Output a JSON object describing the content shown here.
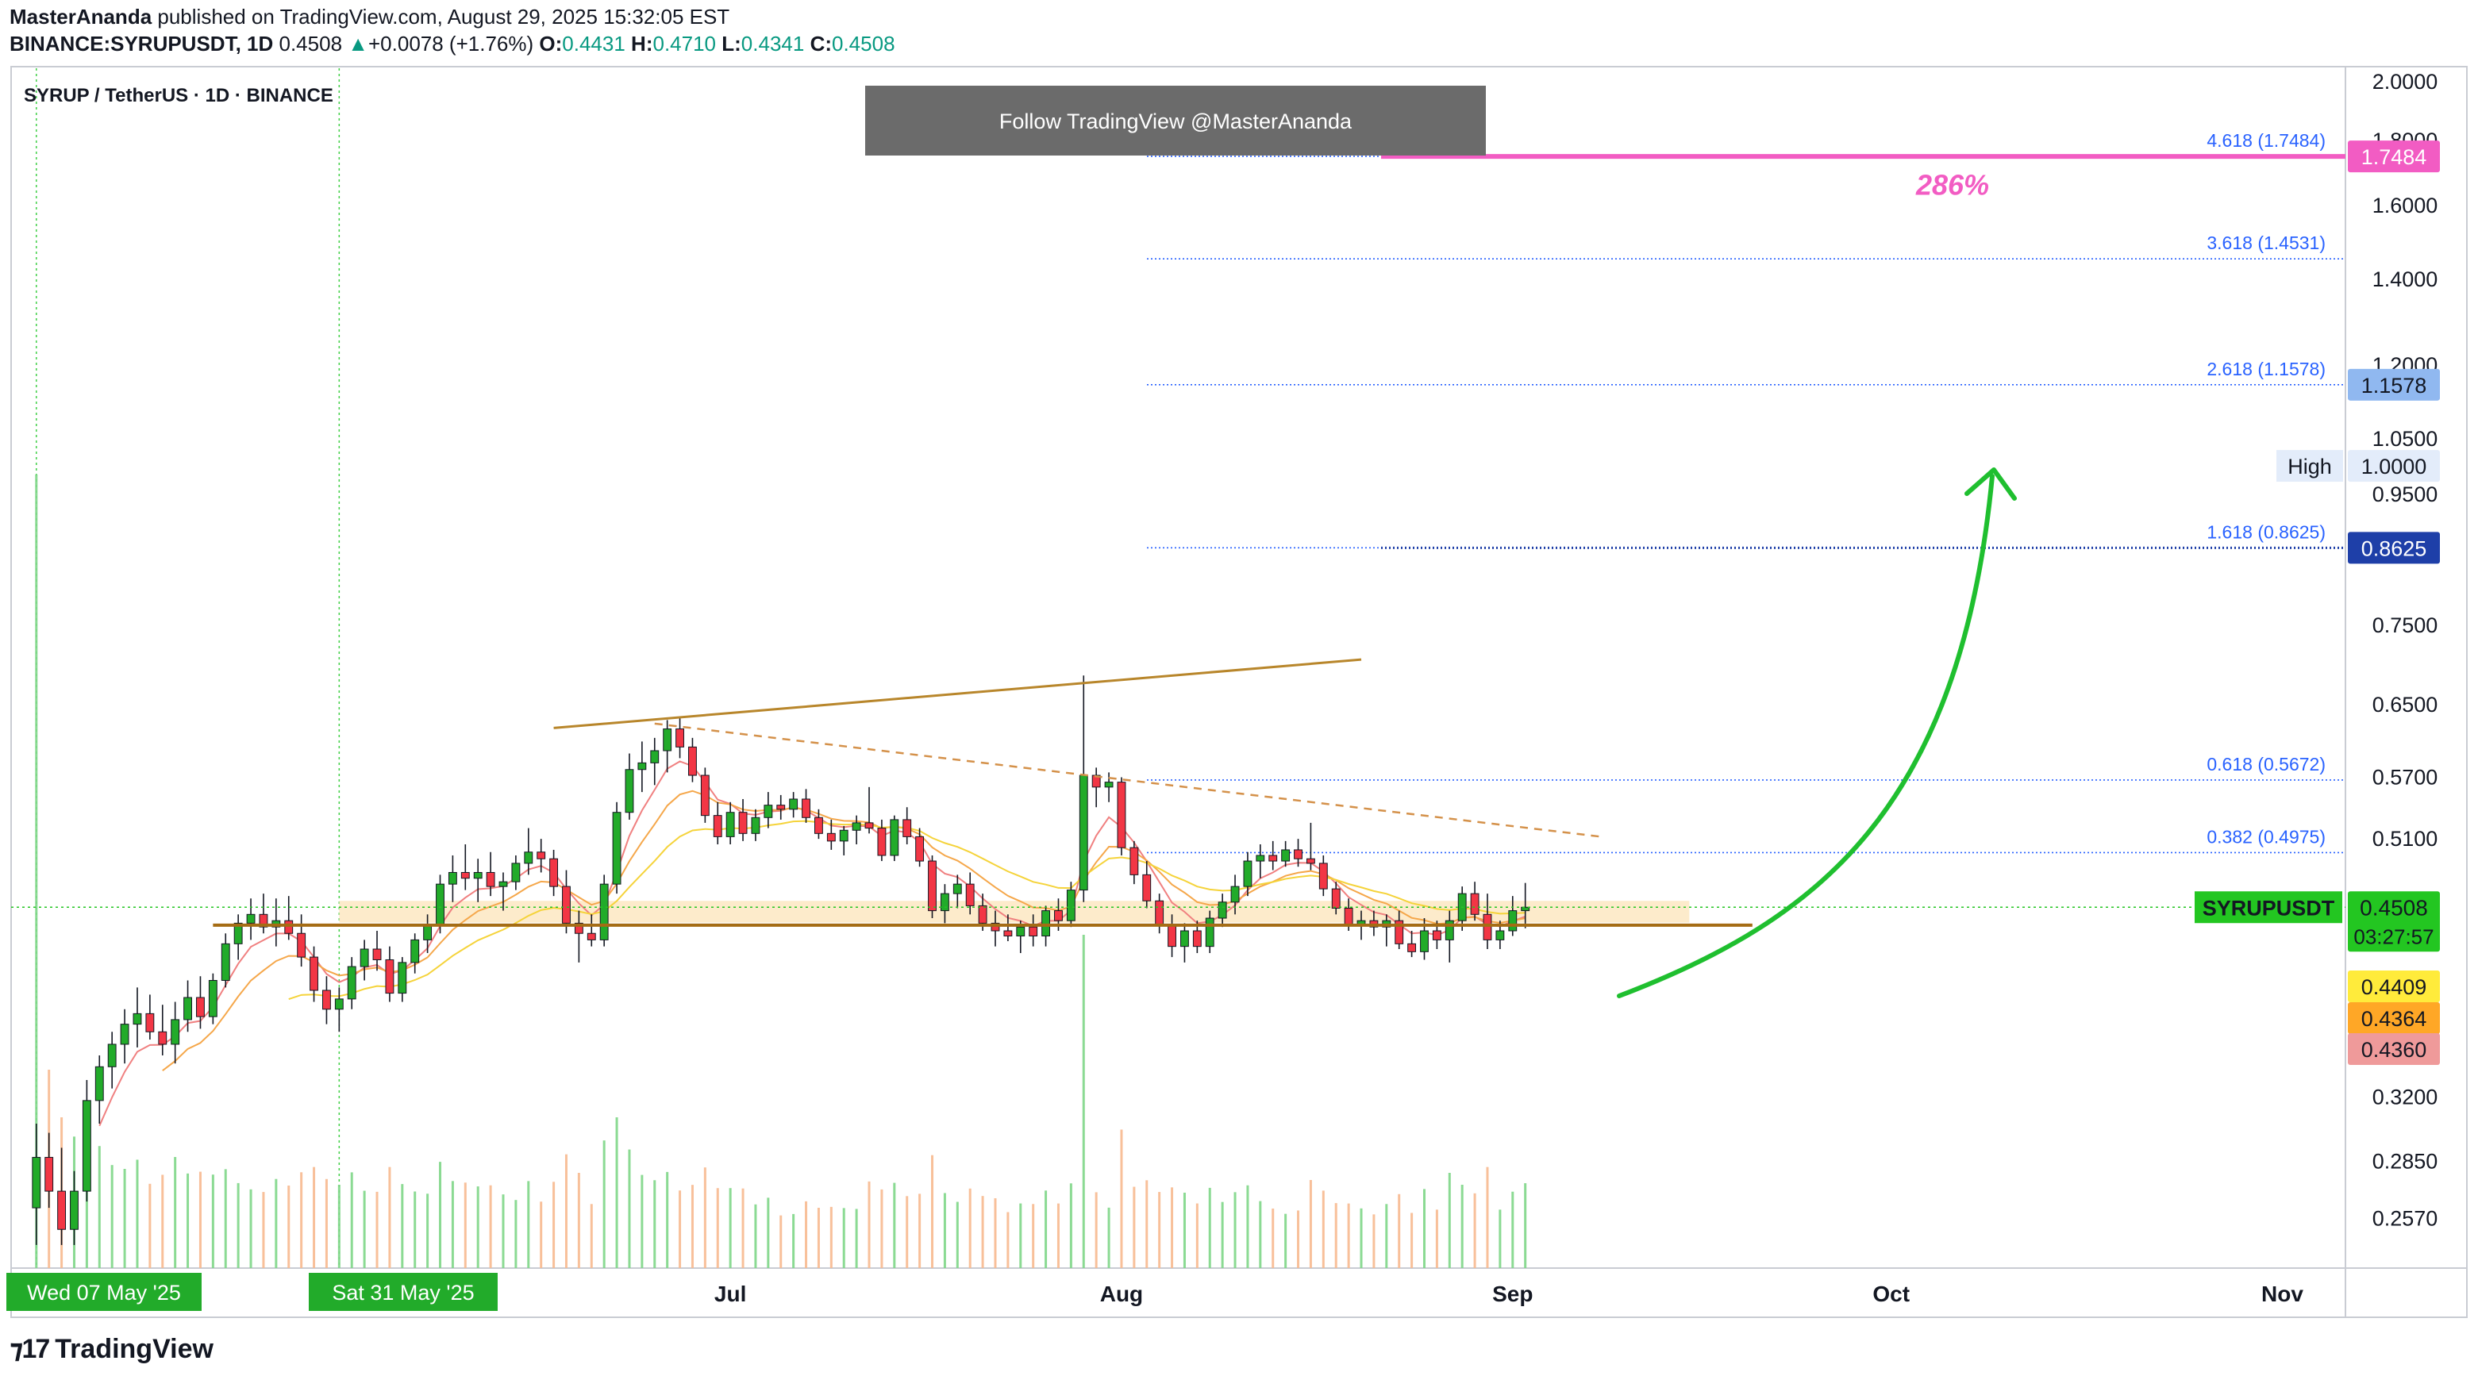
{
  "header": {
    "author": "MasterAnanda",
    "published_text": "published on TradingView.com, August 29, 2025 15:32:05 EST",
    "symbol_line": "BINANCE:SYRUPUSDT, 1D",
    "last": "0.4508",
    "change": "+0.0078 (+1.76%)",
    "open_label": "O:",
    "open": "0.4431",
    "high_label": "H:",
    "high": "0.4710",
    "low_label": "L:",
    "low": "0.4341",
    "close_label": "C:",
    "close": "0.4508"
  },
  "chart_title": "SYRUP / TetherUS · 1D · BINANCE",
  "banner": "Follow TradingView @MasterAnanda",
  "footer": {
    "brand": "TradingView"
  },
  "colors": {
    "up": "#089981",
    "up_candle": "#22ab2a",
    "down_candle": "#f23645",
    "fib": "#2962ff",
    "target": "#f25cc3",
    "arrow": "#1fbf2f",
    "trend": "#b8862b",
    "zone": "#fde7c2",
    "last_price": "#23c621",
    "label_yellow": "#ffeb3b",
    "label_orange": "#ffa726",
    "label_red": "#ef9a9a",
    "label_blue": "#90b8f0",
    "label_navy": "#1e3fa8"
  },
  "chart_data": {
    "type": "candlestick",
    "title": "SYRUP / TetherUS · 1D · BINANCE",
    "y_scale": "log",
    "ylim": [
      0.235,
      2.05
    ],
    "x_range": [
      "2025-05-05",
      "2025-11-06"
    ],
    "x_ticks": [
      {
        "date": "2025-07-01",
        "label": "Jul"
      },
      {
        "date": "2025-08-01",
        "label": "Aug"
      },
      {
        "date": "2025-09-01",
        "label": "Sep"
      },
      {
        "date": "2025-10-01",
        "label": "Oct"
      },
      {
        "date": "2025-11-01",
        "label": "Nov"
      }
    ],
    "x_highlight_labels": [
      {
        "date": "2025-05-07",
        "label": "Wed 07 May '25"
      },
      {
        "date": "2025-05-31",
        "label": "Sat 31 May '25"
      }
    ],
    "y_ticks": [
      "2.0000",
      "1.8000",
      "1.6000",
      "1.4000",
      "1.2000",
      "1.0500",
      "0.9500",
      "0.7500",
      "0.6500",
      "0.5700",
      "0.5100",
      "0.3200",
      "0.2850",
      "0.2570"
    ],
    "candles": [
      {
        "d": "2025-05-07",
        "o": 0.262,
        "h": 0.305,
        "l": 0.245,
        "c": 0.287
      },
      {
        "d": "2025-05-08",
        "o": 0.287,
        "h": 0.3,
        "l": 0.262,
        "c": 0.27
      },
      {
        "d": "2025-05-09",
        "o": 0.27,
        "h": 0.292,
        "l": 0.245,
        "c": 0.252
      },
      {
        "d": "2025-05-10",
        "o": 0.252,
        "h": 0.28,
        "l": 0.245,
        "c": 0.27
      },
      {
        "d": "2025-05-11",
        "o": 0.27,
        "h": 0.33,
        "l": 0.265,
        "c": 0.318
      },
      {
        "d": "2025-05-12",
        "o": 0.318,
        "h": 0.345,
        "l": 0.305,
        "c": 0.338
      },
      {
        "d": "2025-05-13",
        "o": 0.338,
        "h": 0.36,
        "l": 0.325,
        "c": 0.352
      },
      {
        "d": "2025-05-14",
        "o": 0.352,
        "h": 0.375,
        "l": 0.34,
        "c": 0.365
      },
      {
        "d": "2025-05-15",
        "o": 0.365,
        "h": 0.39,
        "l": 0.35,
        "c": 0.372
      },
      {
        "d": "2025-05-16",
        "o": 0.372,
        "h": 0.385,
        "l": 0.355,
        "c": 0.36
      },
      {
        "d": "2025-05-17",
        "o": 0.36,
        "h": 0.378,
        "l": 0.345,
        "c": 0.352
      },
      {
        "d": "2025-05-18",
        "o": 0.352,
        "h": 0.38,
        "l": 0.34,
        "c": 0.368
      },
      {
        "d": "2025-05-19",
        "o": 0.368,
        "h": 0.395,
        "l": 0.36,
        "c": 0.383
      },
      {
        "d": "2025-05-20",
        "o": 0.383,
        "h": 0.398,
        "l": 0.362,
        "c": 0.37
      },
      {
        "d": "2025-05-21",
        "o": 0.37,
        "h": 0.4,
        "l": 0.365,
        "c": 0.395
      },
      {
        "d": "2025-05-22",
        "o": 0.395,
        "h": 0.43,
        "l": 0.39,
        "c": 0.422
      },
      {
        "d": "2025-05-23",
        "o": 0.422,
        "h": 0.445,
        "l": 0.41,
        "c": 0.438
      },
      {
        "d": "2025-05-24",
        "o": 0.438,
        "h": 0.458,
        "l": 0.425,
        "c": 0.445
      },
      {
        "d": "2025-05-25",
        "o": 0.445,
        "h": 0.462,
        "l": 0.43,
        "c": 0.435
      },
      {
        "d": "2025-05-26",
        "o": 0.435,
        "h": 0.458,
        "l": 0.42,
        "c": 0.44
      },
      {
        "d": "2025-05-27",
        "o": 0.44,
        "h": 0.46,
        "l": 0.425,
        "c": 0.43
      },
      {
        "d": "2025-05-28",
        "o": 0.43,
        "h": 0.445,
        "l": 0.405,
        "c": 0.412
      },
      {
        "d": "2025-05-29",
        "o": 0.412,
        "h": 0.42,
        "l": 0.38,
        "c": 0.388
      },
      {
        "d": "2025-05-30",
        "o": 0.388,
        "h": 0.398,
        "l": 0.365,
        "c": 0.375
      },
      {
        "d": "2025-05-31",
        "o": 0.375,
        "h": 0.39,
        "l": 0.36,
        "c": 0.382
      },
      {
        "d": "2025-06-01",
        "o": 0.382,
        "h": 0.412,
        "l": 0.375,
        "c": 0.405
      },
      {
        "d": "2025-06-02",
        "o": 0.405,
        "h": 0.425,
        "l": 0.395,
        "c": 0.418
      },
      {
        "d": "2025-06-03",
        "o": 0.418,
        "h": 0.432,
        "l": 0.402,
        "c": 0.41
      },
      {
        "d": "2025-06-04",
        "o": 0.41,
        "h": 0.42,
        "l": 0.38,
        "c": 0.386
      },
      {
        "d": "2025-06-05",
        "o": 0.386,
        "h": 0.412,
        "l": 0.38,
        "c": 0.408
      },
      {
        "d": "2025-06-06",
        "o": 0.408,
        "h": 0.43,
        "l": 0.4,
        "c": 0.425
      },
      {
        "d": "2025-06-07",
        "o": 0.425,
        "h": 0.445,
        "l": 0.415,
        "c": 0.436
      },
      {
        "d": "2025-06-08",
        "o": 0.436,
        "h": 0.478,
        "l": 0.43,
        "c": 0.47
      },
      {
        "d": "2025-06-09",
        "o": 0.47,
        "h": 0.495,
        "l": 0.455,
        "c": 0.48
      },
      {
        "d": "2025-06-10",
        "o": 0.48,
        "h": 0.505,
        "l": 0.465,
        "c": 0.475
      },
      {
        "d": "2025-06-11",
        "o": 0.475,
        "h": 0.492,
        "l": 0.455,
        "c": 0.48
      },
      {
        "d": "2025-06-12",
        "o": 0.48,
        "h": 0.498,
        "l": 0.46,
        "c": 0.468
      },
      {
        "d": "2025-06-13",
        "o": 0.468,
        "h": 0.48,
        "l": 0.448,
        "c": 0.472
      },
      {
        "d": "2025-06-14",
        "o": 0.472,
        "h": 0.495,
        "l": 0.465,
        "c": 0.488
      },
      {
        "d": "2025-06-15",
        "o": 0.488,
        "h": 0.52,
        "l": 0.478,
        "c": 0.498
      },
      {
        "d": "2025-06-16",
        "o": 0.498,
        "h": 0.51,
        "l": 0.48,
        "c": 0.492
      },
      {
        "d": "2025-06-17",
        "o": 0.492,
        "h": 0.5,
        "l": 0.46,
        "c": 0.468
      },
      {
        "d": "2025-06-18",
        "o": 0.468,
        "h": 0.482,
        "l": 0.43,
        "c": 0.438
      },
      {
        "d": "2025-06-19",
        "o": 0.438,
        "h": 0.448,
        "l": 0.408,
        "c": 0.43
      },
      {
        "d": "2025-06-20",
        "o": 0.43,
        "h": 0.445,
        "l": 0.42,
        "c": 0.425
      },
      {
        "d": "2025-06-21",
        "o": 0.425,
        "h": 0.478,
        "l": 0.42,
        "c": 0.47
      },
      {
        "d": "2025-06-22",
        "o": 0.47,
        "h": 0.545,
        "l": 0.462,
        "c": 0.535
      },
      {
        "d": "2025-06-23",
        "o": 0.535,
        "h": 0.595,
        "l": 0.528,
        "c": 0.578
      },
      {
        "d": "2025-06-24",
        "o": 0.578,
        "h": 0.608,
        "l": 0.555,
        "c": 0.585
      },
      {
        "d": "2025-06-25",
        "o": 0.585,
        "h": 0.612,
        "l": 0.562,
        "c": 0.598
      },
      {
        "d": "2025-06-26",
        "o": 0.598,
        "h": 0.632,
        "l": 0.575,
        "c": 0.622
      },
      {
        "d": "2025-06-27",
        "o": 0.622,
        "h": 0.635,
        "l": 0.59,
        "c": 0.602
      },
      {
        "d": "2025-06-28",
        "o": 0.602,
        "h": 0.612,
        "l": 0.565,
        "c": 0.572
      },
      {
        "d": "2025-06-29",
        "o": 0.572,
        "h": 0.58,
        "l": 0.525,
        "c": 0.532
      },
      {
        "d": "2025-06-30",
        "o": 0.532,
        "h": 0.545,
        "l": 0.505,
        "c": 0.512
      },
      {
        "d": "2025-07-01",
        "o": 0.512,
        "h": 0.545,
        "l": 0.505,
        "c": 0.535
      },
      {
        "d": "2025-07-02",
        "o": 0.535,
        "h": 0.548,
        "l": 0.508,
        "c": 0.515
      },
      {
        "d": "2025-07-03",
        "o": 0.515,
        "h": 0.538,
        "l": 0.508,
        "c": 0.53
      },
      {
        "d": "2025-07-04",
        "o": 0.53,
        "h": 0.555,
        "l": 0.52,
        "c": 0.542
      },
      {
        "d": "2025-07-05",
        "o": 0.542,
        "h": 0.552,
        "l": 0.528,
        "c": 0.538
      },
      {
        "d": "2025-07-06",
        "o": 0.538,
        "h": 0.555,
        "l": 0.53,
        "c": 0.548
      },
      {
        "d": "2025-07-07",
        "o": 0.548,
        "h": 0.558,
        "l": 0.525,
        "c": 0.53
      },
      {
        "d": "2025-07-08",
        "o": 0.53,
        "h": 0.538,
        "l": 0.51,
        "c": 0.515
      },
      {
        "d": "2025-07-09",
        "o": 0.515,
        "h": 0.528,
        "l": 0.5,
        "c": 0.508
      },
      {
        "d": "2025-07-10",
        "o": 0.508,
        "h": 0.522,
        "l": 0.495,
        "c": 0.518
      },
      {
        "d": "2025-07-11",
        "o": 0.518,
        "h": 0.532,
        "l": 0.505,
        "c": 0.525
      },
      {
        "d": "2025-07-12",
        "o": 0.525,
        "h": 0.56,
        "l": 0.515,
        "c": 0.52
      },
      {
        "d": "2025-07-13",
        "o": 0.52,
        "h": 0.528,
        "l": 0.49,
        "c": 0.495
      },
      {
        "d": "2025-07-14",
        "o": 0.495,
        "h": 0.532,
        "l": 0.49,
        "c": 0.528
      },
      {
        "d": "2025-07-15",
        "o": 0.528,
        "h": 0.54,
        "l": 0.505,
        "c": 0.512
      },
      {
        "d": "2025-07-16",
        "o": 0.512,
        "h": 0.52,
        "l": 0.485,
        "c": 0.49
      },
      {
        "d": "2025-07-17",
        "o": 0.49,
        "h": 0.495,
        "l": 0.442,
        "c": 0.448
      },
      {
        "d": "2025-07-18",
        "o": 0.448,
        "h": 0.47,
        "l": 0.438,
        "c": 0.462
      },
      {
        "d": "2025-07-19",
        "o": 0.462,
        "h": 0.478,
        "l": 0.45,
        "c": 0.47
      },
      {
        "d": "2025-07-20",
        "o": 0.47,
        "h": 0.48,
        "l": 0.445,
        "c": 0.452
      },
      {
        "d": "2025-07-21",
        "o": 0.452,
        "h": 0.462,
        "l": 0.432,
        "c": 0.438
      },
      {
        "d": "2025-07-22",
        "o": 0.438,
        "h": 0.448,
        "l": 0.42,
        "c": 0.432
      },
      {
        "d": "2025-07-23",
        "o": 0.432,
        "h": 0.445,
        "l": 0.424,
        "c": 0.428
      },
      {
        "d": "2025-07-24",
        "o": 0.428,
        "h": 0.44,
        "l": 0.415,
        "c": 0.435
      },
      {
        "d": "2025-07-25",
        "o": 0.435,
        "h": 0.445,
        "l": 0.42,
        "c": 0.428
      },
      {
        "d": "2025-07-26",
        "o": 0.428,
        "h": 0.452,
        "l": 0.42,
        "c": 0.448
      },
      {
        "d": "2025-07-27",
        "o": 0.448,
        "h": 0.458,
        "l": 0.432,
        "c": 0.44
      },
      {
        "d": "2025-07-28",
        "o": 0.44,
        "h": 0.472,
        "l": 0.435,
        "c": 0.465
      },
      {
        "d": "2025-07-29",
        "o": 0.465,
        "h": 0.685,
        "l": 0.455,
        "c": 0.572
      },
      {
        "d": "2025-07-30",
        "o": 0.572,
        "h": 0.58,
        "l": 0.54,
        "c": 0.56
      },
      {
        "d": "2025-07-31",
        "o": 0.56,
        "h": 0.575,
        "l": 0.545,
        "c": 0.565
      },
      {
        "d": "2025-08-01",
        "o": 0.565,
        "h": 0.57,
        "l": 0.495,
        "c": 0.502
      },
      {
        "d": "2025-08-02",
        "o": 0.502,
        "h": 0.508,
        "l": 0.47,
        "c": 0.478
      },
      {
        "d": "2025-08-03",
        "o": 0.478,
        "h": 0.49,
        "l": 0.45,
        "c": 0.456
      },
      {
        "d": "2025-08-04",
        "o": 0.456,
        "h": 0.462,
        "l": 0.43,
        "c": 0.436
      },
      {
        "d": "2025-08-05",
        "o": 0.436,
        "h": 0.445,
        "l": 0.412,
        "c": 0.42
      },
      {
        "d": "2025-08-06",
        "o": 0.42,
        "h": 0.438,
        "l": 0.408,
        "c": 0.432
      },
      {
        "d": "2025-08-07",
        "o": 0.432,
        "h": 0.44,
        "l": 0.415,
        "c": 0.42
      },
      {
        "d": "2025-08-08",
        "o": 0.42,
        "h": 0.448,
        "l": 0.415,
        "c": 0.442
      },
      {
        "d": "2025-08-09",
        "o": 0.442,
        "h": 0.462,
        "l": 0.435,
        "c": 0.455
      },
      {
        "d": "2025-08-10",
        "o": 0.455,
        "h": 0.478,
        "l": 0.445,
        "c": 0.468
      },
      {
        "d": "2025-08-11",
        "o": 0.468,
        "h": 0.498,
        "l": 0.46,
        "c": 0.49
      },
      {
        "d": "2025-08-12",
        "o": 0.49,
        "h": 0.505,
        "l": 0.475,
        "c": 0.495
      },
      {
        "d": "2025-08-13",
        "o": 0.495,
        "h": 0.508,
        "l": 0.482,
        "c": 0.49
      },
      {
        "d": "2025-08-14",
        "o": 0.49,
        "h": 0.508,
        "l": 0.485,
        "c": 0.5
      },
      {
        "d": "2025-08-15",
        "o": 0.5,
        "h": 0.51,
        "l": 0.485,
        "c": 0.492
      },
      {
        "d": "2025-08-16",
        "o": 0.492,
        "h": 0.525,
        "l": 0.482,
        "c": 0.488
      },
      {
        "d": "2025-08-17",
        "o": 0.488,
        "h": 0.495,
        "l": 0.46,
        "c": 0.466
      },
      {
        "d": "2025-08-18",
        "o": 0.466,
        "h": 0.472,
        "l": 0.445,
        "c": 0.45
      },
      {
        "d": "2025-08-19",
        "o": 0.45,
        "h": 0.458,
        "l": 0.432,
        "c": 0.436
      },
      {
        "d": "2025-08-20",
        "o": 0.436,
        "h": 0.448,
        "l": 0.425,
        "c": 0.44
      },
      {
        "d": "2025-08-21",
        "o": 0.44,
        "h": 0.448,
        "l": 0.428,
        "c": 0.435
      },
      {
        "d": "2025-08-22",
        "o": 0.435,
        "h": 0.445,
        "l": 0.42,
        "c": 0.44
      },
      {
        "d": "2025-08-23",
        "o": 0.44,
        "h": 0.448,
        "l": 0.418,
        "c": 0.422
      },
      {
        "d": "2025-08-24",
        "o": 0.422,
        "h": 0.432,
        "l": 0.412,
        "c": 0.416
      },
      {
        "d": "2025-08-25",
        "o": 0.416,
        "h": 0.442,
        "l": 0.41,
        "c": 0.432
      },
      {
        "d": "2025-08-26",
        "o": 0.432,
        "h": 0.44,
        "l": 0.418,
        "c": 0.425
      },
      {
        "d": "2025-08-27",
        "o": 0.425,
        "h": 0.448,
        "l": 0.408,
        "c": 0.44
      },
      {
        "d": "2025-08-28",
        "o": 0.44,
        "h": 0.468,
        "l": 0.432,
        "c": 0.462
      },
      {
        "d": "2025-08-29",
        "o": 0.462,
        "h": 0.472,
        "l": 0.44,
        "c": 0.445
      },
      {
        "d": "2025-08-30",
        "o": 0.445,
        "h": 0.462,
        "l": 0.418,
        "c": 0.425
      },
      {
        "d": "2025-08-31",
        "o": 0.425,
        "h": 0.44,
        "l": 0.418,
        "c": 0.432
      },
      {
        "d": "2025-09-01",
        "o": 0.432,
        "h": 0.46,
        "l": 0.428,
        "c": 0.448
      },
      {
        "d": "2025-09-02",
        "o": 0.448,
        "h": 0.471,
        "l": 0.434,
        "c": 0.4508
      }
    ],
    "fib_levels": [
      {
        "label": "4.618 (1.7484)",
        "price": 1.7484
      },
      {
        "label": "3.618 (1.4531)",
        "price": 1.4531
      },
      {
        "label": "2.618 (1.1578)",
        "price": 1.1578
      },
      {
        "label": "1.618 (0.8625)",
        "price": 0.8625
      },
      {
        "label": "0.618 (0.5672)",
        "price": 0.5672
      },
      {
        "label": "0.382 (0.4975)",
        "price": 0.4975
      }
    ],
    "price_labels": [
      {
        "text": "1.7484",
        "price": 1.7484,
        "role": "target"
      },
      {
        "text": "1.1578",
        "price": 1.1578,
        "role": "fib"
      },
      {
        "text": "1.0000",
        "price": 1.0,
        "role": "high",
        "tag": "High"
      },
      {
        "text": "0.8625",
        "price": 0.8625,
        "role": "fib-strong"
      },
      {
        "text": "0.4409",
        "price": 0.4409,
        "role": "ema-yellow"
      },
      {
        "text": "0.4364",
        "price": 0.4364,
        "role": "ema-orange"
      },
      {
        "text": "0.4360",
        "price": 0.436,
        "role": "ema-red"
      }
    ],
    "last_price": {
      "symbol": "SYRUPUSDT",
      "price": 0.4508,
      "text": "0.4508",
      "countdown": "03:27:57"
    },
    "target_annotation": {
      "text": "286%",
      "price": 1.66
    },
    "support_zone": {
      "low": 0.4385,
      "high": 0.456,
      "from": "2025-05-31",
      "to": "2025-09-15"
    },
    "support_line": {
      "price": 0.4364,
      "from": "2025-05-21",
      "to": "2025-09-20"
    },
    "resistance_line": {
      "from": [
        "2025-06-17",
        0.623
      ],
      "to": [
        "2025-08-20",
        0.705
      ]
    },
    "dashed_trendline": {
      "from": [
        "2025-06-25",
        0.628
      ],
      "to": [
        "2025-09-08",
        0.512
      ]
    }
  }
}
